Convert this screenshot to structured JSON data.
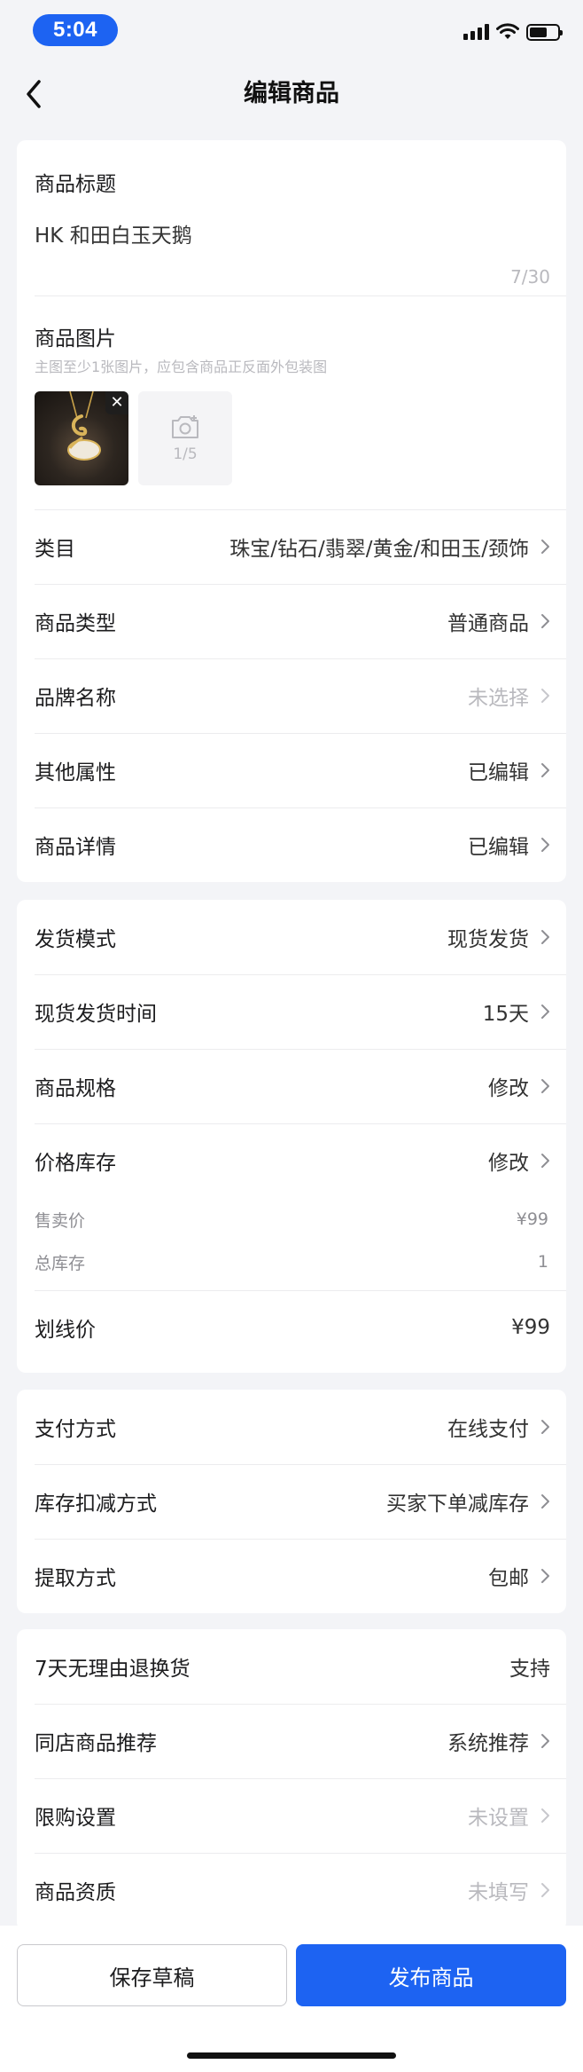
{
  "status_bar": {
    "time": "5:04"
  },
  "header": {
    "title": "编辑商品"
  },
  "title_section": {
    "label": "商品标题",
    "value": "HK 和田白玉天鹅",
    "count": "7/30"
  },
  "images_section": {
    "label": "商品图片",
    "hint": "主图至少1张图片，应包含商品正反面外包装图",
    "upload_count": "1/5"
  },
  "basic_rows": [
    {
      "label": "类目",
      "value": "珠宝/钻石/翡翠/黄金/和田玉/颈饰"
    },
    {
      "label": "商品类型",
      "value": "普通商品"
    },
    {
      "label": "品牌名称",
      "value": "未选择"
    },
    {
      "label": "其他属性",
      "value": "已编辑"
    },
    {
      "label": "商品详情",
      "value": "已编辑"
    }
  ],
  "shipping_rows": [
    {
      "label": "发货模式",
      "value": "现货发货"
    },
    {
      "label": "现货发货时间",
      "value": "15天"
    },
    {
      "label": "商品规格",
      "value": "修改"
    },
    {
      "label": "价格库存",
      "value": "修改"
    }
  ],
  "price_details": [
    {
      "label": "售卖价",
      "value": "¥99"
    },
    {
      "label": "总库存",
      "value": "1"
    }
  ],
  "strike_price": {
    "label": "划线价",
    "value": "¥99"
  },
  "payment_rows": [
    {
      "label": "支付方式",
      "value": "在线支付"
    },
    {
      "label": "库存扣减方式",
      "value": "买家下单减库存"
    },
    {
      "label": "提取方式",
      "value": "包邮"
    }
  ],
  "service_rows": [
    {
      "label": "7天无理由退换货",
      "value": "支持"
    },
    {
      "label": "同店商品推荐",
      "value": "系统推荐"
    },
    {
      "label": "限购设置",
      "value": "未设置"
    },
    {
      "label": "商品资质",
      "value": "未填写"
    }
  ],
  "actions": {
    "save_draft": "保存草稿",
    "publish": "发布商品"
  },
  "colors": {
    "accent": "#1d63f2",
    "background": "#f3f4f7",
    "muted_text": "#b9b9be"
  },
  "icons": [
    "back-chevron-icon",
    "camera-add-icon",
    "close-icon",
    "chevron-right-icon",
    "signal-icon",
    "wifi-icon",
    "battery-icon"
  ]
}
